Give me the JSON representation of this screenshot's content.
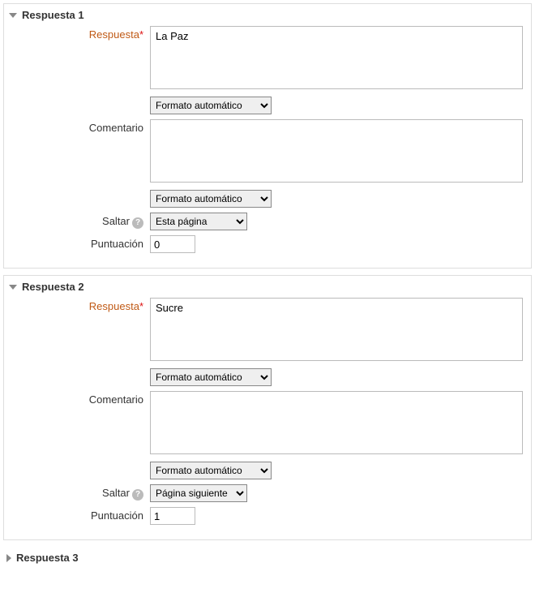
{
  "answers": [
    {
      "header": "Respuesta 1",
      "expanded": true,
      "respuesta_label": "Respuesta",
      "respuesta_value": "La Paz",
      "format1_selected": "Formato automático",
      "comentario_label": "Comentario",
      "comentario_value": "",
      "format2_selected": "Formato automático",
      "saltar_label": "Saltar",
      "saltar_selected": "Esta página",
      "puntuacion_label": "Puntuación",
      "puntuacion_value": "0"
    },
    {
      "header": "Respuesta 2",
      "expanded": true,
      "respuesta_label": "Respuesta",
      "respuesta_value": "Sucre",
      "format1_selected": "Formato automático",
      "comentario_label": "Comentario",
      "comentario_value": "",
      "format2_selected": "Formato automático",
      "saltar_label": "Saltar",
      "saltar_selected": "Página siguiente",
      "puntuacion_label": "Puntuación",
      "puntuacion_value": "1"
    },
    {
      "header": "Respuesta 3",
      "expanded": false
    }
  ],
  "format_options": [
    "Formato automático"
  ],
  "saltar_options": [
    "Esta página",
    "Página siguiente"
  ]
}
